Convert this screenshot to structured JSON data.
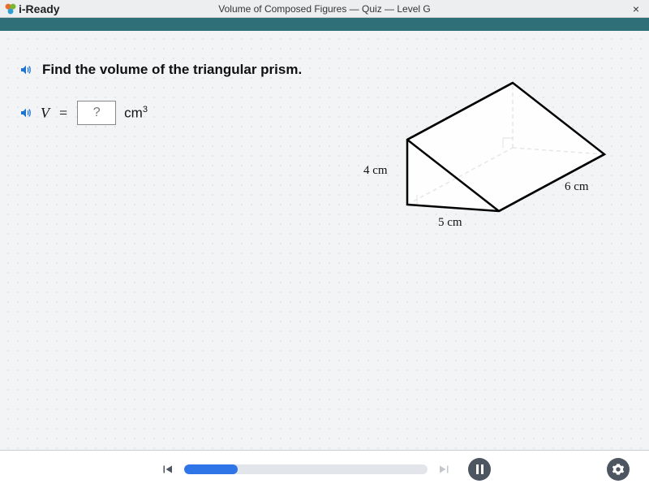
{
  "title": "Volume of Composed Figures — Quiz — Level G",
  "brand": "i-Ready",
  "question": "Find the volume of the triangular prism.",
  "formula": {
    "var": "V",
    "eq": "=",
    "placeholder": "?",
    "unit": "cm",
    "exp": "3"
  },
  "dimensions": {
    "a": "4 cm",
    "b": "5 cm",
    "c": "6 cm"
  },
  "progress_percent": 22
}
